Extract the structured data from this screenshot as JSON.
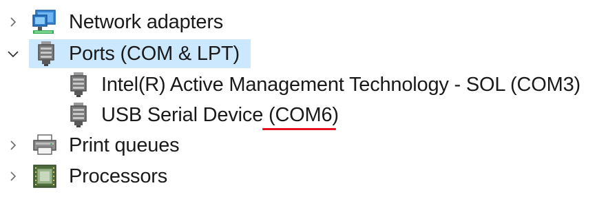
{
  "tree": {
    "items": [
      {
        "label": "Network adapters",
        "expanded": false,
        "icon": "network-adapter-icon"
      },
      {
        "label": "Ports (COM & LPT)",
        "expanded": true,
        "selected": true,
        "icon": "port-connector-icon",
        "children": [
          {
            "label": "Intel(R) Active Management Technology - SOL (COM3)",
            "icon": "port-connector-icon"
          },
          {
            "label": "USB Serial Device (COM6)",
            "icon": "port-connector-icon",
            "annotation": "red-underline-COM6"
          }
        ]
      },
      {
        "label": "Print queues",
        "expanded": false,
        "icon": "printer-icon"
      },
      {
        "label": "Processors",
        "expanded": false,
        "icon": "processor-chip-icon"
      }
    ]
  },
  "colors": {
    "selection": "#cce8ff",
    "annotation": "#e81123",
    "text": "#1a1a1a",
    "chevron": "#6a6a6a"
  }
}
